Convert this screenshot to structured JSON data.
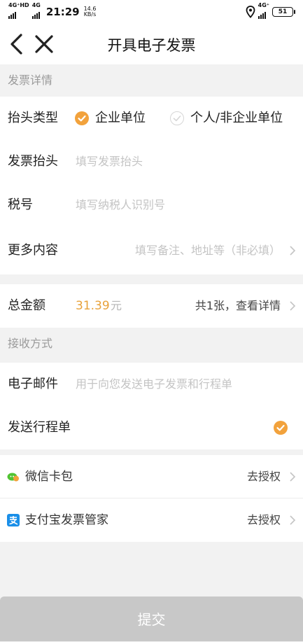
{
  "status_bar": {
    "network1": "4G⁺HD",
    "network2": "4G",
    "time": "21:29",
    "speed_value": "14.6",
    "speed_unit": "KB/s",
    "network3": "4G⁺",
    "battery": "51"
  },
  "nav": {
    "title": "开具电子发票",
    "back_icon": "chevron-left-icon",
    "close_icon": "close-icon"
  },
  "invoice_details": {
    "section_title": "发票详情",
    "header_type": {
      "label": "抬头类型",
      "options": [
        {
          "label": "企业单位",
          "selected": true
        },
        {
          "label": "个人/非企业单位",
          "selected": false
        }
      ]
    },
    "invoice_title": {
      "label": "发票抬头",
      "placeholder": "填写发票抬头"
    },
    "tax_number": {
      "label": "税号",
      "placeholder": "填写纳税人识别号"
    },
    "more_content": {
      "label": "更多内容",
      "placeholder": "填写备注、地址等（非必填）"
    }
  },
  "total": {
    "label": "总金额",
    "amount": "31.39",
    "unit": "元",
    "detail_text": "共1张，查看详情"
  },
  "receive": {
    "section_title": "接收方式",
    "email": {
      "label": "电子邮件",
      "placeholder": "用于向您发送电子发票和行程单"
    },
    "send_itinerary": {
      "label": "发送行程单",
      "checked": true
    }
  },
  "wallets": [
    {
      "name": "微信卡包",
      "action": "去授权",
      "icon": "wechat-card-icon"
    },
    {
      "name": "支付宝发票管家",
      "action": "去授权",
      "icon": "alipay-icon"
    }
  ],
  "submit_label": "提交",
  "colors": {
    "accent": "#f2a23c",
    "amount": "#e8a23b",
    "submit_bg": "#c8c8c8",
    "page_bg": "#f2f2f2"
  }
}
